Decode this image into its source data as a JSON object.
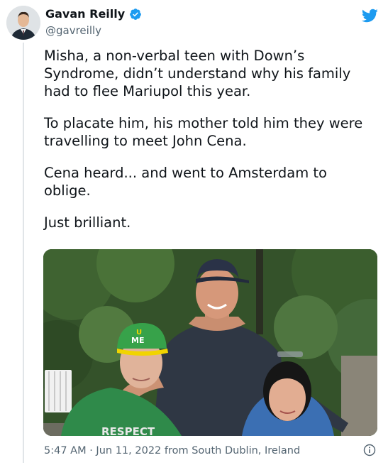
{
  "author": {
    "name": "Gavan Reilly",
    "handle": "@gavreilly"
  },
  "tweet": {
    "paragraphs": [
      "Misha, a non-verbal teen with Down’s Syndrome, didn’t understand why his family had to flee Mariupol this year.",
      "To placate him, his mother told him they were travelling to meet John Cena.",
      "Cena heard... and went to Amsterdam to oblige.",
      "Just brilliant."
    ],
    "timestamp": "5:47 AM · Jun 11, 2022 from South Dublin, Ireland"
  },
  "photo": {
    "cap_text_1": "U",
    "cap_text_2": "ME",
    "shirt_text": "RESPECT"
  },
  "colors": {
    "twitter_blue": "#1d9bf0",
    "text_primary": "#0f1419",
    "text_secondary": "#536471"
  },
  "icons": {
    "verified": "verified-badge-icon",
    "brand": "twitter-bird-icon",
    "info": "info-icon"
  }
}
